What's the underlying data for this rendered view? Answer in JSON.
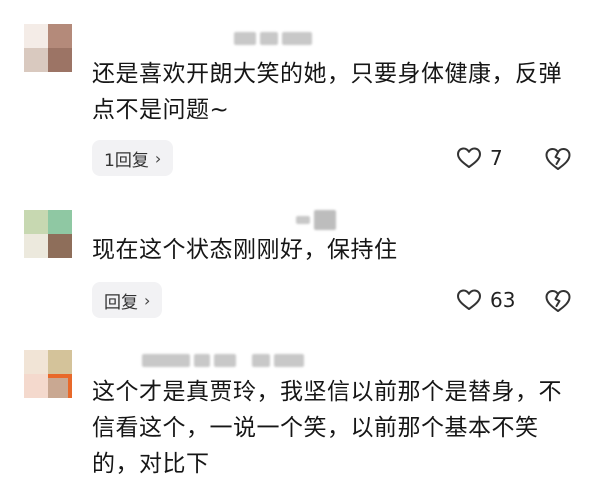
{
  "comments": [
    {
      "text": "还是喜欢开朗大笑的她，只要身体健康，反弹点不是问题~",
      "reply_label": "1回复",
      "like_count": "7",
      "avatar_colors": [
        "#e8d6cc",
        "#b98b7c",
        "#d9c3b8",
        "#a57869"
      ]
    },
    {
      "text": "现在这个状态刚刚好，保持住",
      "reply_label": "回复",
      "like_count": "63",
      "avatar_colors": [
        "#c7d8b1",
        "#a4cfa4",
        "#c5c1a6",
        "#8e7a62"
      ]
    },
    {
      "text": "这个才是真贾玲，我坚信以前那个是替身，不信看这个，一说一个笑，以前那个基本不笑的，对比下",
      "avatar_colors": [
        "#f1e4d6",
        "#d4c39a",
        "#f4d9cd",
        "#c9a892"
      ]
    }
  ],
  "icons": {
    "chevron": "chevron-right-icon",
    "heart": "heart-icon",
    "dislike": "broken-heart-icon"
  }
}
